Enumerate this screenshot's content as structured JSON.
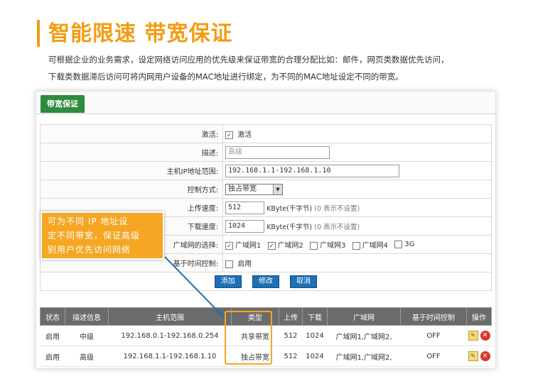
{
  "header": {
    "title": "智能限速 带宽保证",
    "desc_line1": "可根据企业的业务需求，设定网络访问应用的优先级来保证带宽的合理分配比如：邮件，网页类数据优先访问，",
    "desc_line2": "下载类数据滞后访问可将内网用户设备的MAC地址进行绑定，为不同的MAC地址设定不同的带宽。"
  },
  "colors": {
    "accent": "#f39c12",
    "tab_green": "#2e8b3e",
    "button_blue": "#1e6fb4"
  },
  "tab": {
    "label": "带宽保证"
  },
  "form": {
    "activate": {
      "label": "激活:",
      "checkbox_label": "激活",
      "checked": true
    },
    "description": {
      "label": "描述:",
      "placeholder": "高级"
    },
    "ip_range": {
      "label": "主机IP地址范围:",
      "value": "192.168.1.1-192.168.1.10"
    },
    "control_mode": {
      "label": "控制方式:",
      "selected": "独占带宽"
    },
    "upload": {
      "label": "上传速度:",
      "value": "512",
      "unit": "KByte(千字节)",
      "hint": "(0 表示不设置)"
    },
    "download": {
      "label": "下载速度:",
      "value": "1024",
      "unit": "KByte(千字节)",
      "hint": "(0 表示不设置)"
    },
    "wan_select": {
      "label": "广域网的选择:",
      "options": [
        {
          "label": "广域网1",
          "checked": true
        },
        {
          "label": "广域网2",
          "checked": true
        },
        {
          "label": "广域网3",
          "checked": false
        },
        {
          "label": "广域网4",
          "checked": false
        },
        {
          "label": "3G",
          "checked": false
        }
      ]
    },
    "time_control": {
      "label": "基于时间控制:",
      "checkbox_label": "启用",
      "checked": false
    },
    "buttons": {
      "add": "添加",
      "modify": "修改",
      "cancel": "取消"
    }
  },
  "table": {
    "headers": [
      "状态",
      "描述信息",
      "主机范围",
      "类型",
      "上传",
      "下载",
      "广域网",
      "基于时间控制",
      "操作"
    ],
    "rows": [
      {
        "status": "启用",
        "desc": "中级",
        "range": "192.168.0.1-192.168.0.254",
        "type": "共享带宽",
        "up": "512",
        "down": "1024",
        "wan": "广域网1,广域网2,",
        "time": "OFF"
      },
      {
        "status": "启用",
        "desc": "高级",
        "range": "192.168.1.1-192.168.1.10",
        "type": "独占带宽",
        "up": "512",
        "down": "1024",
        "wan": "广域网1,广域网2,",
        "time": "OFF"
      }
    ]
  },
  "callout": {
    "line1": "可为不同 IP 地址设",
    "line2": "定不同带宽，保证高级",
    "line3": "别用户优先访问网络"
  }
}
